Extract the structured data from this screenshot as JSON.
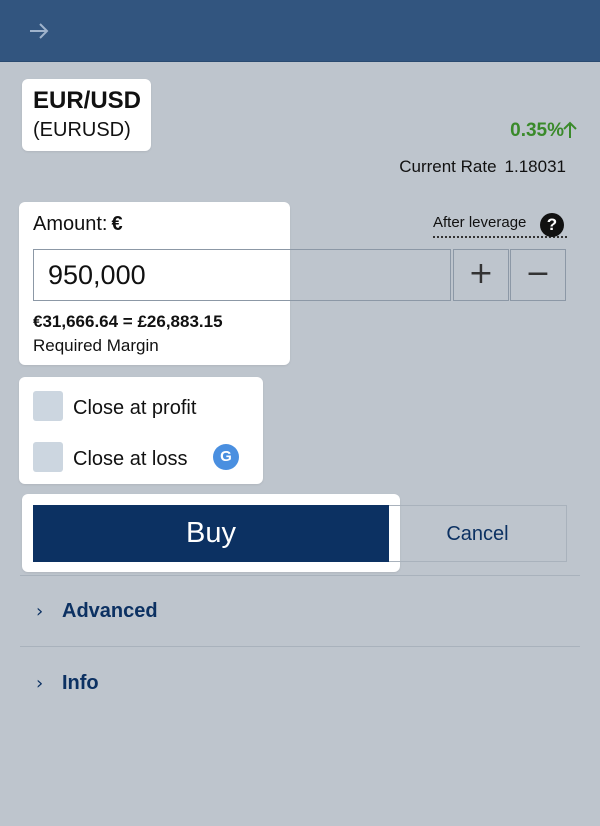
{
  "header": {
    "back_icon": "arrow-right-icon"
  },
  "instrument": {
    "symbol": "EUR/USD",
    "code": "(EURUSD)"
  },
  "quote": {
    "change": "0.35%",
    "change_icon": "arrow-up-icon",
    "change_color": "#3a8a2a",
    "rate_label": "Current Rate",
    "rate_value": "1.18031"
  },
  "amount": {
    "label": "Amount:",
    "currency": "€",
    "value": "950,000",
    "after_leverage": "After leverage",
    "help_icon": "?",
    "plus": "+",
    "minus": "−",
    "conversion": "€31,666.64 = £26,883.15",
    "margin_label": "Required Margin"
  },
  "options": {
    "close_at_profit": "Close at profit",
    "close_at_loss": "Close at loss",
    "badge": "G"
  },
  "actions": {
    "buy": "Buy",
    "cancel": "Cancel"
  },
  "sections": {
    "advanced": "Advanced",
    "info": "Info",
    "chevron": "›"
  },
  "colors": {
    "header": "#32557f",
    "primary": "#0c3162",
    "background": "#bec5cd"
  }
}
